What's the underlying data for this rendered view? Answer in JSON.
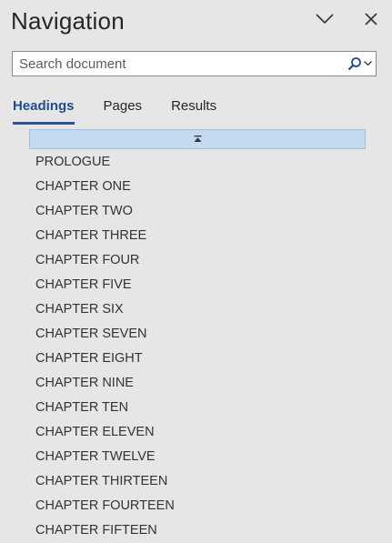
{
  "header": {
    "title": "Navigation",
    "options_icon": "chevron-down-icon",
    "close_icon": "close-icon"
  },
  "search": {
    "placeholder": "Search document",
    "value": "",
    "icon": "search-icon"
  },
  "tabs": [
    {
      "label": "Headings",
      "active": true
    },
    {
      "label": "Pages",
      "active": false
    },
    {
      "label": "Results",
      "active": false
    }
  ],
  "collapse_icon": "collapse-all-icon",
  "headings": [
    "PROLOGUE",
    "CHAPTER ONE",
    "CHAPTER TWO",
    "CHAPTER THREE",
    "CHAPTER FOUR",
    "CHAPTER FIVE",
    "CHAPTER SIX",
    "CHAPTER SEVEN",
    "CHAPTER EIGHT",
    "CHAPTER NINE",
    "CHAPTER TEN",
    "CHAPTER ELEVEN",
    "CHAPTER TWELVE",
    "CHAPTER THIRTEEN",
    "CHAPTER FOURTEEN",
    "CHAPTER FIFTEEN"
  ],
  "colors": {
    "background": "#e6e6e6",
    "accent": "#2b579a",
    "active_tab_text": "#1f4e8c",
    "selection_bar": "#c5d9f1"
  }
}
